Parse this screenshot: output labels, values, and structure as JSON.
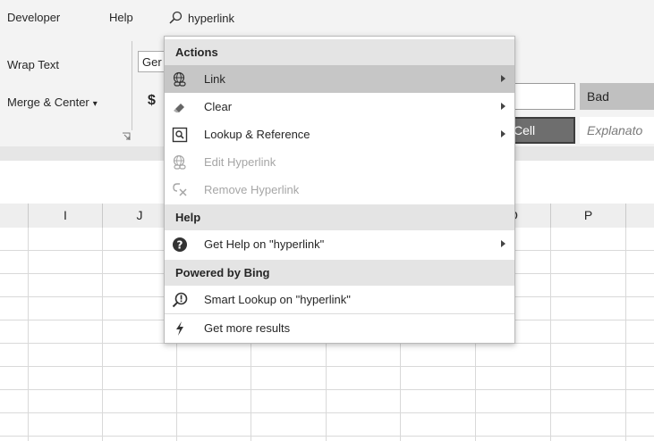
{
  "menubar": {
    "developer": "Developer",
    "help": "Help",
    "search_query": "hyperlink"
  },
  "ribbon": {
    "wrap_text": "Wrap Text",
    "merge_center": "Merge & Center",
    "merge_dropdown": "▾",
    "number_format": "Ger",
    "currency": "$",
    "style_bad": "Bad",
    "style_check_cell": "Cell",
    "style_explanatory": "Explanato"
  },
  "columns": [
    "",
    "I",
    "J",
    "",
    "",
    "",
    "",
    "O",
    "P",
    ""
  ],
  "dropdown": {
    "sections": {
      "actions": "Actions",
      "help": "Help",
      "bing": "Powered by Bing"
    },
    "items": {
      "link": "Link",
      "clear": "Clear",
      "lookup_reference": "Lookup & Reference",
      "edit_hyperlink": "Edit Hyperlink",
      "remove_hyperlink": "Remove Hyperlink",
      "get_help": "Get Help on \"hyperlink\"",
      "smart_lookup": "Smart Lookup on \"hyperlink\"",
      "get_more": "Get more results"
    }
  },
  "colors": {
    "ribbon_bg": "#f3f3f3",
    "highlight": "#c6c6c6",
    "section_header": "#e4e4e4",
    "disabled_text": "#a6a6a6"
  }
}
